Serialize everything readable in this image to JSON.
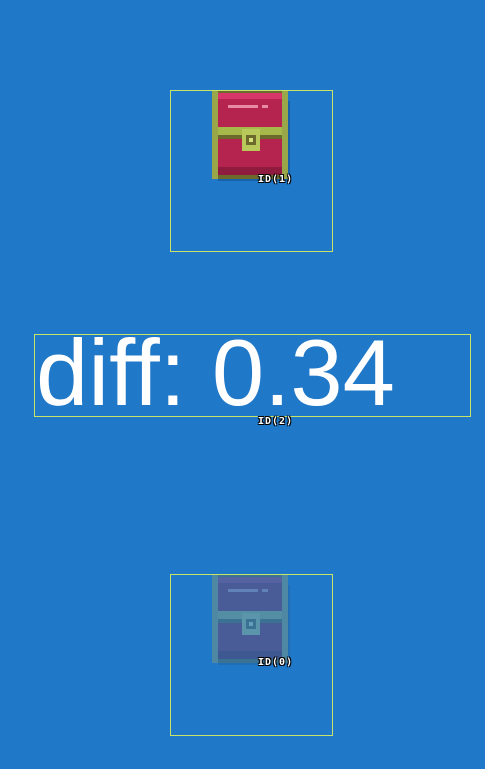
{
  "scene": {
    "background_color": "#1f78c8",
    "box_color": "#c7e36a"
  },
  "objects": [
    {
      "kind": "treasure-chest",
      "id_label": "ID(1)",
      "appearance": "bright"
    },
    {
      "kind": "diff-text",
      "id_label": "ID(2)",
      "text": "diff: 0.34"
    },
    {
      "kind": "treasure-chest",
      "id_label": "ID(0)",
      "appearance": "faded"
    }
  ],
  "icons": [
    "treasure-chest-icon"
  ]
}
